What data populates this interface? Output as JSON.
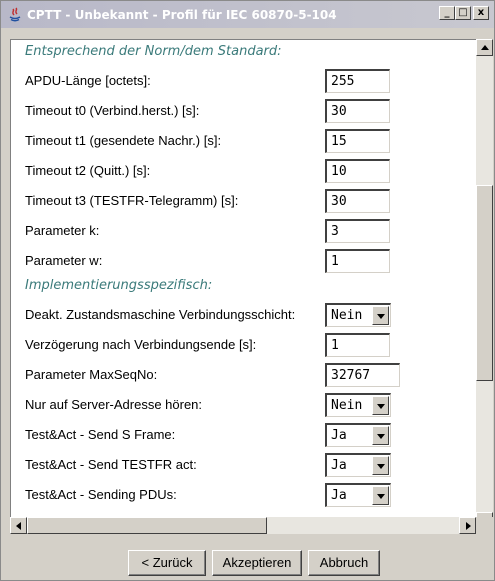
{
  "window": {
    "title": "CPTT - Unbekannt - Profil für IEC 60870-5-104",
    "min_glyph": "_",
    "max_glyph": "□",
    "close_glyph": "x"
  },
  "sections": {
    "standard": "Entsprechend der Norm/dem Standard:",
    "impl": "Implementierungsspezifisch:"
  },
  "fields": [
    {
      "label": "APDU-Länge [octets]:",
      "value": "255"
    },
    {
      "label": "Timeout t0 (Verbind.herst.) [s]:",
      "value": "30"
    },
    {
      "label": "Timeout t1 (gesendete Nachr.) [s]:",
      "value": "15"
    },
    {
      "label": "Timeout t2 (Quitt.) [s]:",
      "value": "10"
    },
    {
      "label": "Timeout t3 (TESTFR-Telegramm) [s]:",
      "value": "30"
    },
    {
      "label": "Parameter k:",
      "value": "3"
    },
    {
      "label": "Parameter w:",
      "value": "1"
    }
  ],
  "impl_fields": [
    {
      "label": "Deakt. Zustandsmaschine Verbindungsschicht:",
      "value": "Nein"
    },
    {
      "label": "Verzögerung nach Verbindungsende [s]:",
      "value": "1"
    },
    {
      "label": "Parameter MaxSeqNo:",
      "value": "32767"
    },
    {
      "label": "Nur auf Server-Adresse hören:",
      "value": "Nein"
    },
    {
      "label": "Test&Act - Send S Frame:",
      "value": "Ja"
    },
    {
      "label": "Test&Act - Send TESTFR act:",
      "value": "Ja"
    },
    {
      "label": "Test&Act - Sending PDUs:",
      "value": "Ja"
    }
  ],
  "buttons": {
    "back": "< Zurück",
    "accept": "Akzeptieren",
    "cancel": "Abbruch"
  }
}
